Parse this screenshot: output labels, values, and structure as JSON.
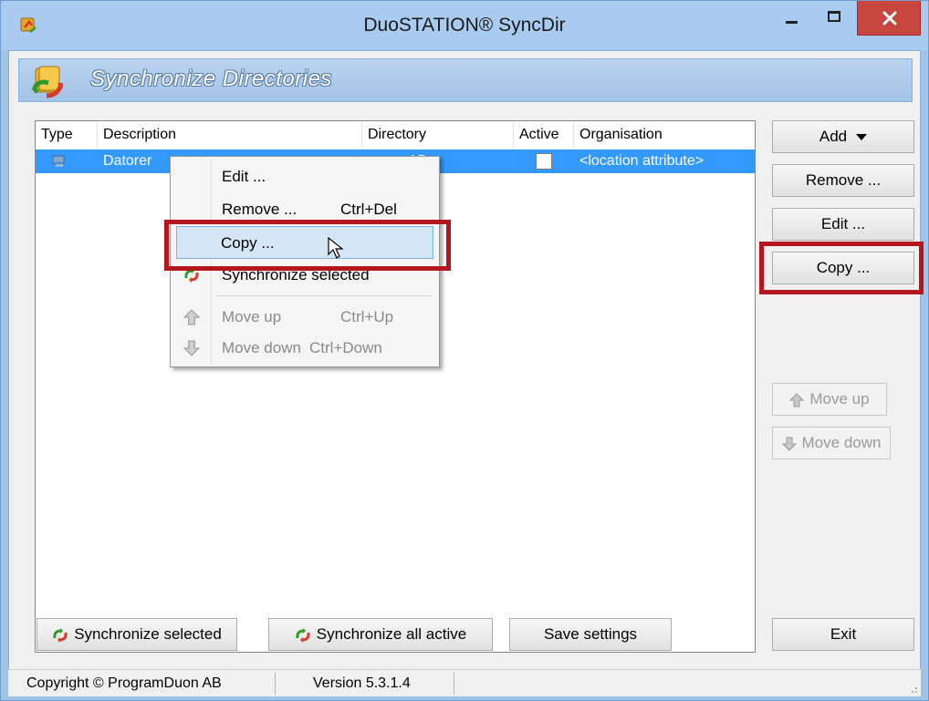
{
  "window": {
    "title": "DuoSTATION® SyncDir",
    "close_symbol": "✕"
  },
  "banner": {
    "title": "Synchronize Directories"
  },
  "list": {
    "columns": [
      "Type",
      "Description",
      "Directory",
      "Active",
      "Organisation"
    ],
    "rows": [
      {
        "type_icon": "computer-icon",
        "description": "Datorer",
        "directory": "AB",
        "active": false,
        "organisation": "<location attribute>"
      }
    ]
  },
  "context_menu": {
    "items": [
      {
        "label": "Edit ...",
        "shortcut": "",
        "enabled": true
      },
      {
        "label": "Remove ...",
        "shortcut": "Ctrl+Del",
        "enabled": true
      },
      {
        "label": "Copy ...",
        "shortcut": "",
        "enabled": true,
        "hovered": true
      },
      {
        "label": "Synchronize selected",
        "shortcut": "",
        "enabled": true,
        "icon": "sync-icon"
      },
      {
        "label": "Move up",
        "shortcut": "Ctrl+Up",
        "enabled": false,
        "icon": "arrow-up-icon"
      },
      {
        "label": "Move down",
        "shortcut": "Ctrl+Down",
        "enabled": false,
        "icon": "arrow-down-icon"
      }
    ]
  },
  "side_buttons": {
    "add": "Add",
    "remove": "Remove ...",
    "edit": "Edit ...",
    "copy": "Copy ...",
    "move_up": "Move up",
    "move_down": "Move down"
  },
  "bottom_buttons": {
    "sync_selected": "Synchronize selected",
    "sync_all": "Synchronize all active",
    "save": "Save settings",
    "exit": "Exit"
  },
  "statusbar": {
    "copyright": "Copyright © ProgramDuon AB",
    "version": "Version 5.3.1.4"
  },
  "colors": {
    "selection": "#3399ff",
    "highlight_border": "#b3161c",
    "close_button": "#c7463d",
    "titlebar": "#a9cbef"
  }
}
